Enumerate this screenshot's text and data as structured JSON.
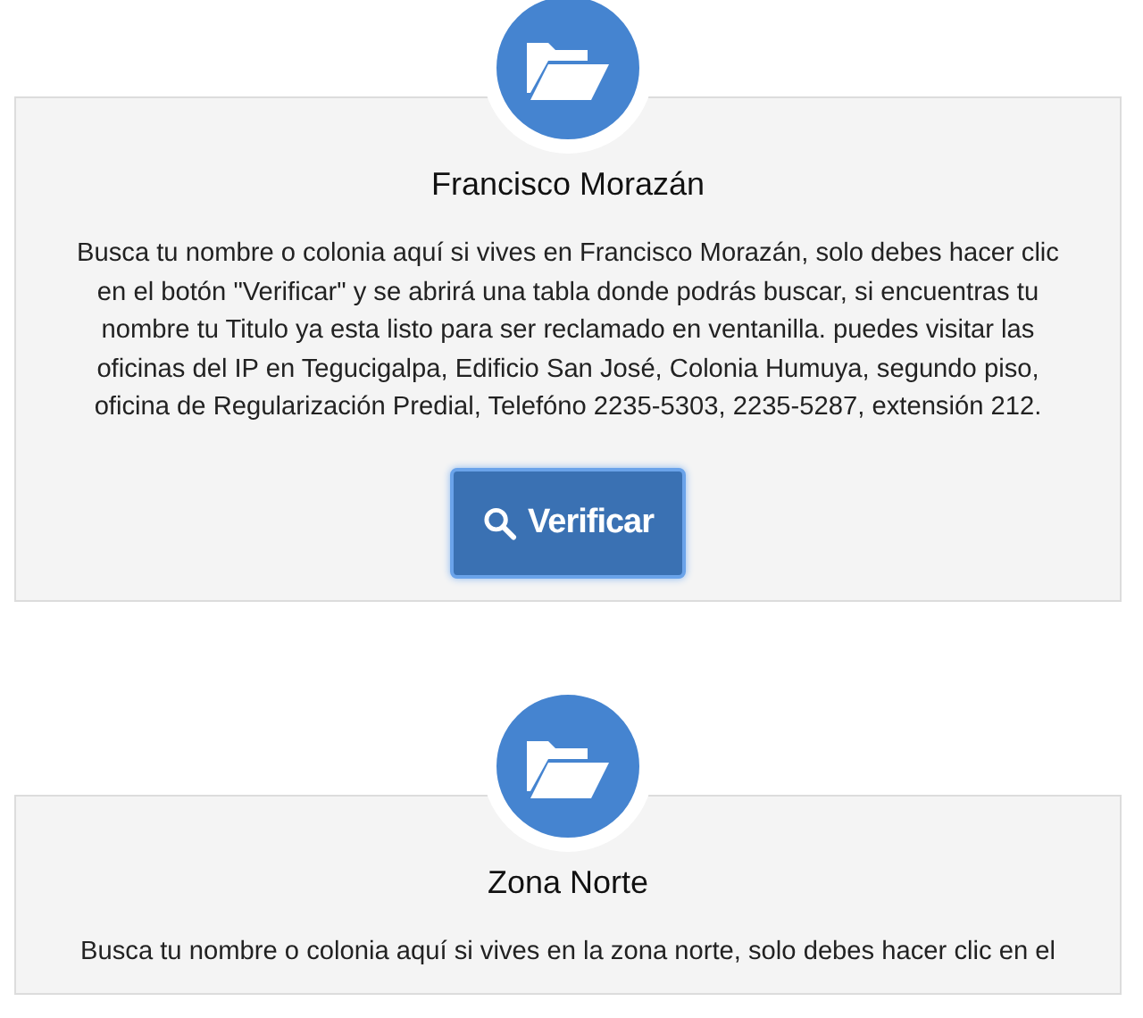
{
  "sections": [
    {
      "title": "Francisco Morazán",
      "text": "Busca tu nombre o colonia aquí si vives en Francisco Morazán, solo debes hacer clic en el botón \"Verificar\" y se abrirá una tabla donde podrás buscar, si encuentras tu nombre tu Titulo ya esta listo para ser reclamado en ventanilla. puedes visitar las oficinas del IP en Tegucigalpa, Edificio San José, Colonia Humuya, segundo piso, oficina de Regularización Predial, Telefóno 2235-5303, 2235-5287, extensión 212.",
      "button": "Verificar"
    },
    {
      "title": "Zona Norte",
      "text": "Busca tu nombre o colonia aquí si vives en la zona norte, solo debes hacer clic en el"
    }
  ]
}
